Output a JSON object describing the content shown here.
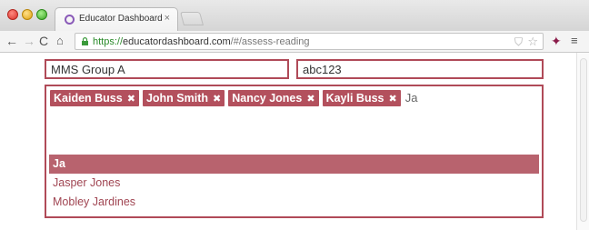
{
  "browser": {
    "tab_title": "Educator Dashboard",
    "tab_close": "×",
    "url_scheme": "https://",
    "url_host": "educatordashboard.com",
    "url_path": "/#/assess-reading",
    "icons": {
      "back": "←",
      "forward": "→",
      "reload": "C",
      "home": "⌂",
      "shield": "⛉",
      "star": "☆",
      "extension": "✦",
      "menu": "≡"
    }
  },
  "form": {
    "group_name": "MMS Group A",
    "code": "abc123",
    "tags": [
      {
        "label": "Kaiden Buss",
        "remove": "✖"
      },
      {
        "label": "John Smith",
        "remove": "✖"
      },
      {
        "label": "Nancy Jones",
        "remove": "✖"
      },
      {
        "label": "Kayli Buss",
        "remove": "✖"
      }
    ],
    "tag_query": "Ja",
    "suggestions": [
      {
        "label": "Ja",
        "active": true
      },
      {
        "label": "Jasper Jones",
        "active": false
      },
      {
        "label": "Mobley Jardines",
        "active": false
      }
    ]
  },
  "colors": {
    "accent": "#b04a58",
    "tag_bg": "#b3505d",
    "suggestion_active_bg": "#b8636e",
    "suggestion_text": "#a04552",
    "url_green": "#2a8a2a"
  }
}
